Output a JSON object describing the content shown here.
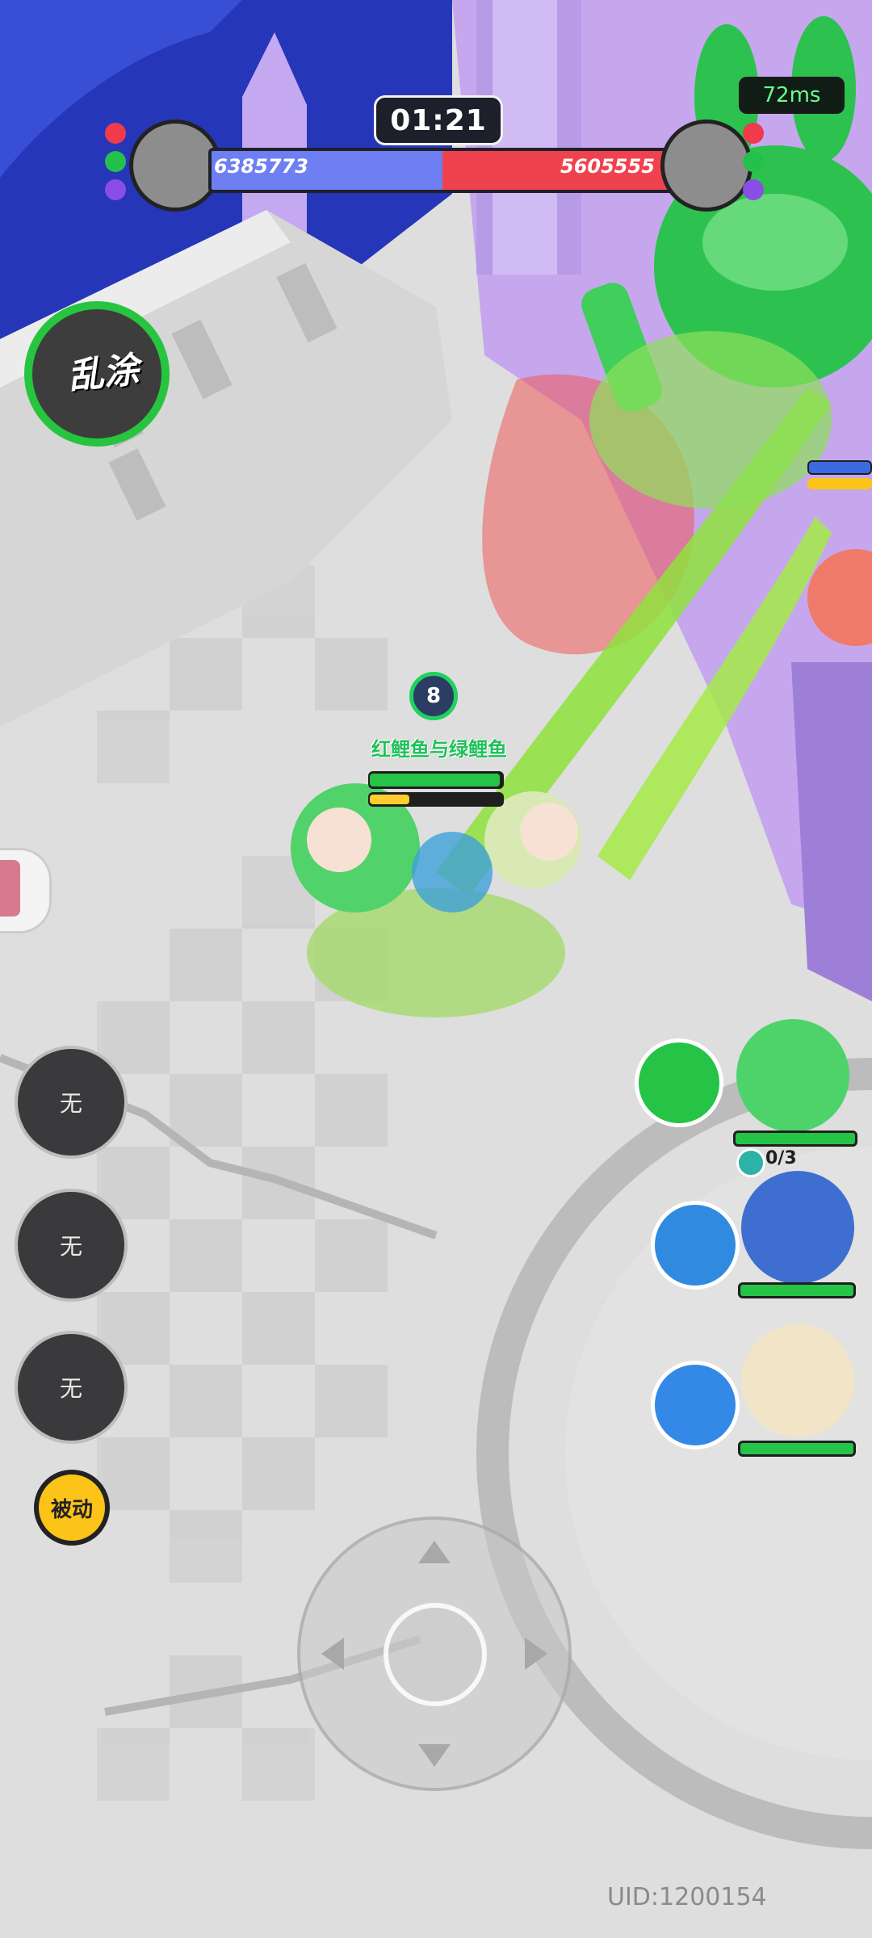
{
  "hud": {
    "timer": "01:21",
    "ping": "72ms",
    "left_team_score": "6385773",
    "right_team_score": "5605555"
  },
  "main_skill": {
    "label": "乱涂",
    "icon": "paint-splat-icon"
  },
  "player": {
    "level": "8",
    "name": "红鲤鱼与绿鲤鱼",
    "hp_fraction": 0.98,
    "energy_fraction": 0.3
  },
  "item_slots": [
    {
      "label": "无"
    },
    {
      "label": "无"
    },
    {
      "label": "无"
    }
  ],
  "passive_button": {
    "label": "被动"
  },
  "teammates": [
    {
      "icon": "bunny-skill-icon",
      "hp_fraction": 1.0,
      "ammo": "0/3"
    },
    {
      "icon": "wave-skill-icon",
      "hp_fraction": 1.0
    },
    {
      "icon": "ghost-skill-icon",
      "hp_fraction": 1.0
    }
  ],
  "uid": "UID:1200154",
  "colors": {
    "team_blue": "#6d7ff2",
    "team_red": "#f0424e",
    "accent_green": "#25c346",
    "passive_yellow": "#fcc419"
  }
}
